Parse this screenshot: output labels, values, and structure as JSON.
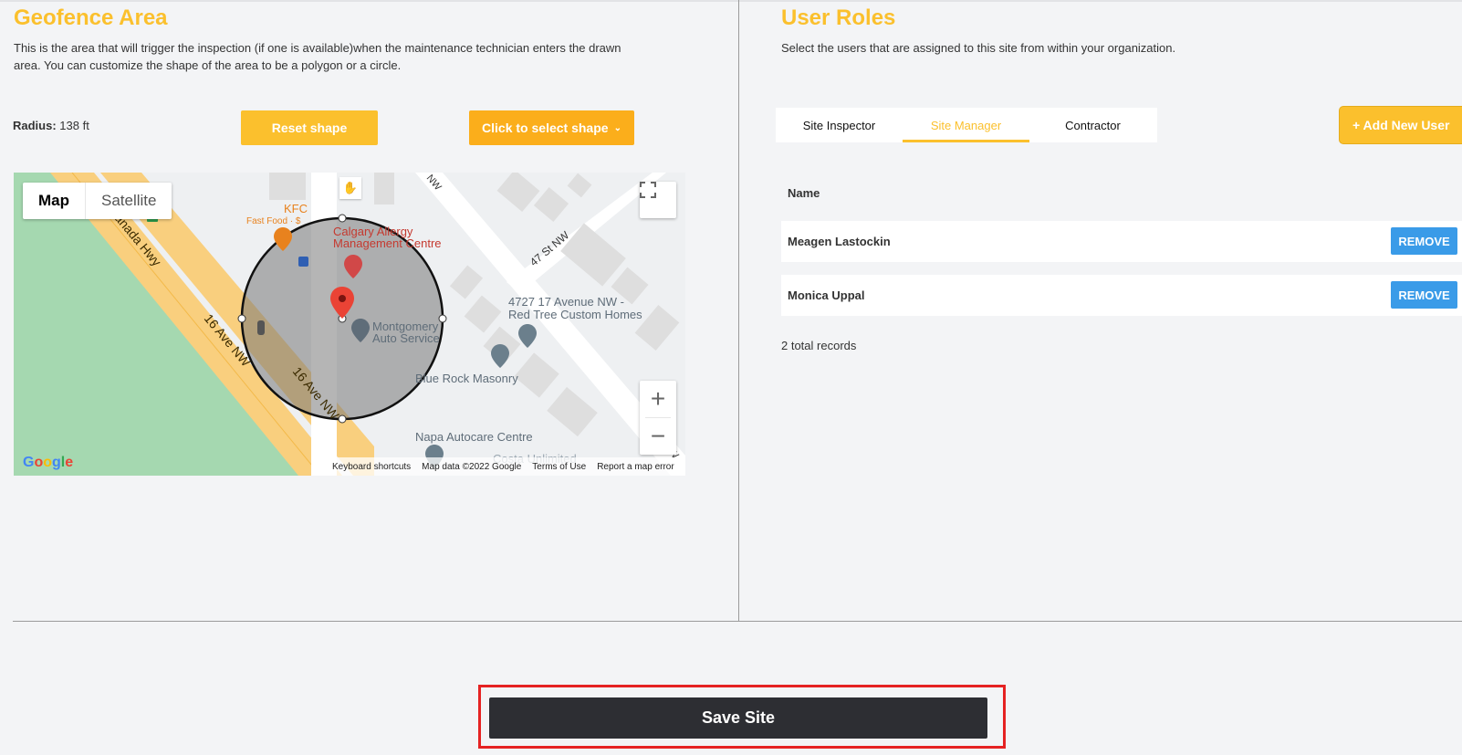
{
  "geofence": {
    "title": "Geofence Area",
    "description": "This is the area that will trigger the inspection (if one is available)when the maintenance technician enters the drawn area. You can customize the shape of the area to be a polygon or a circle.",
    "radius_label": "Radius:",
    "radius_value": "138 ft",
    "reset_label": "Reset shape",
    "select_shape_label": "Click to select shape",
    "map": {
      "map_tab": "Map",
      "satellite_tab": "Satellite",
      "labels": {
        "kfc": "KFC",
        "fast_food": "Fast Food · $",
        "canada_hwy": "anada Hwy",
        "calgary_1": "Calgary Allergy",
        "calgary_2": "Management Centre",
        "st47": "47 St NW",
        "address_1": "4727 17 Avenue NW -",
        "address_2": "Red Tree Custom Homes",
        "montgomery_1": "Montgomery",
        "montgomery_2": "Auto Service",
        "blue_rock": "Blue Rock Masonry",
        "ave16_a": "16 Ave NW",
        "ave16_b": "16 Ave NW",
        "napa": "Napa Autocare Centre",
        "partial_label": "Costa Unlimited",
        "nw": "NW"
      },
      "zoom_in": "+",
      "zoom_out": "−",
      "google": "Google",
      "footer": {
        "shortcuts": "Keyboard shortcuts",
        "map_data": "Map data ©2022 Google",
        "terms": "Terms of Use",
        "report": "Report a map error"
      }
    }
  },
  "user_roles": {
    "title": "User Roles",
    "description": "Select the users that are assigned to this site from within your organization.",
    "tabs": [
      {
        "label": "Site Inspector",
        "active": false
      },
      {
        "label": "Site Manager",
        "active": true
      },
      {
        "label": "Contractor",
        "active": false
      }
    ],
    "add_label": "+ Add New User",
    "column_name": "Name",
    "rows": [
      {
        "name": "Meagen Lastockin",
        "action": "REMOVE"
      },
      {
        "name": "Monica Uppal",
        "action": "REMOVE"
      }
    ],
    "total": "2 total records"
  },
  "footer": {
    "save_label": "Save Site"
  },
  "colors": {
    "accent": "#fbc02d",
    "remove_blue": "#3a9be8",
    "save_dark": "#2d2e33",
    "highlight_red": "#e52222"
  }
}
